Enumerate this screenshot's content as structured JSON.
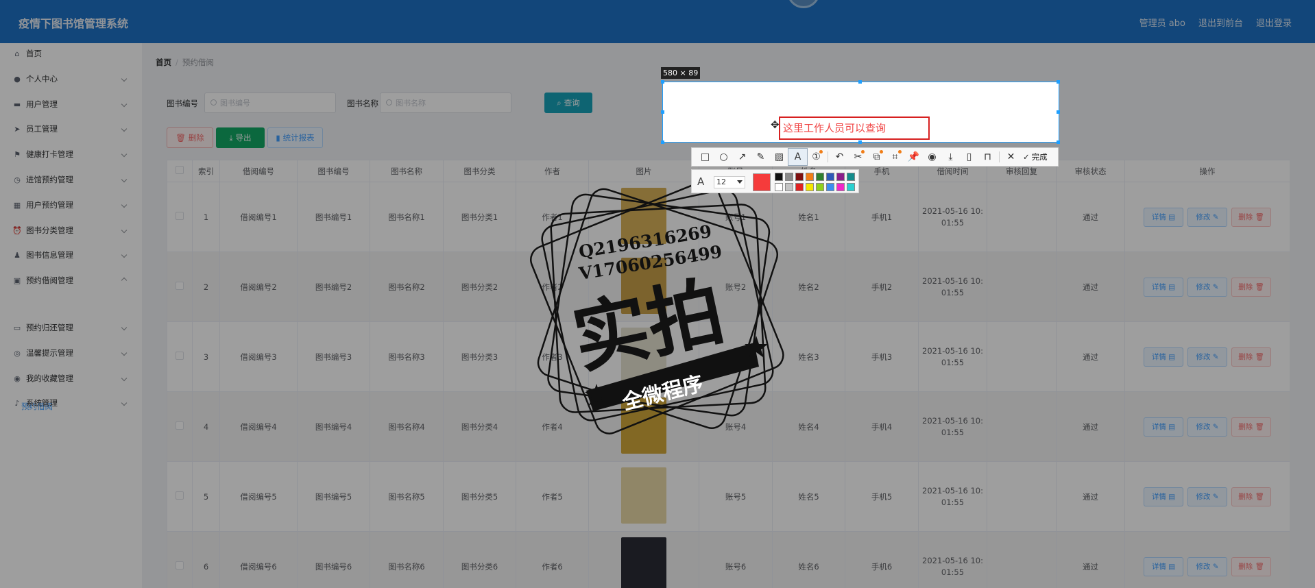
{
  "app_title": "疫情下图书馆管理系统",
  "header_links": [
    "管理员 abo",
    "退出到前台",
    "退出登录"
  ],
  "sidebar": {
    "items": [
      {
        "label": "首页",
        "icon": "home-icon",
        "glyph": "⌂",
        "chevron": "none"
      },
      {
        "label": "个人中心",
        "icon": "user-icon",
        "glyph": "●",
        "chevron": "down"
      },
      {
        "label": "用户管理",
        "icon": "users-icon",
        "glyph": "▬",
        "chevron": "down"
      },
      {
        "label": "员工管理",
        "icon": "send-icon",
        "glyph": "➤",
        "chevron": "down"
      },
      {
        "label": "健康打卡管理",
        "icon": "flag-icon",
        "glyph": "⚑",
        "chevron": "down"
      },
      {
        "label": "进馆预约管理",
        "icon": "clock-icon",
        "glyph": "◷",
        "chevron": "down"
      },
      {
        "label": "用户预约管理",
        "icon": "grid-icon",
        "glyph": "▦",
        "chevron": "down"
      },
      {
        "label": "图书分类管理",
        "icon": "alarm-icon",
        "glyph": "⏰",
        "chevron": "down"
      },
      {
        "label": "图书信息管理",
        "icon": "person-icon",
        "glyph": "♟",
        "chevron": "down"
      },
      {
        "label": "预约借阅管理",
        "icon": "apps-icon",
        "glyph": "▣",
        "chevron": "up"
      },
      {
        "label": "预约归还管理",
        "icon": "chat-icon",
        "glyph": "▭",
        "chevron": "down"
      },
      {
        "label": "温馨提示管理",
        "icon": "compass-icon",
        "glyph": "◎",
        "chevron": "down"
      },
      {
        "label": "我的收藏管理",
        "icon": "support-icon",
        "glyph": "◉",
        "chevron": "down"
      },
      {
        "label": "系统管理",
        "icon": "mic-icon",
        "glyph": "♪",
        "chevron": "down"
      }
    ],
    "active_sub": "预约借阅"
  },
  "breadcrumb": {
    "home": "首页",
    "sep": "/",
    "current": "预约借阅"
  },
  "search": {
    "label1": "图书编号",
    "placeholder1": "图书编号",
    "label2": "图书名称",
    "placeholder2": "图书名称",
    "query": "查询"
  },
  "buttons": {
    "delete": "删除",
    "export": "导出",
    "report": "统计报表"
  },
  "table": {
    "headers": [
      "",
      "索引",
      "借阅编号",
      "图书编号",
      "图书名称",
      "图书分类",
      "作者",
      "图片",
      "账号",
      "姓名",
      "手机",
      "借阅时间",
      "审核回复",
      "审核状态",
      "操作"
    ],
    "rows": [
      {
        "idx": "1",
        "borrow_no": "借阅编号1",
        "book_no": "图书编号1",
        "book_name": "图书名称1",
        "category": "图书分类1",
        "author": "作者1",
        "account": "账号1",
        "name": "姓名1",
        "phone": "手机1",
        "time1": "2021-05-16 10:",
        "time2": "01:55",
        "reply": "",
        "status": "通过",
        "cover": "#d9b25a"
      },
      {
        "idx": "2",
        "borrow_no": "借阅编号2",
        "book_no": "图书编号2",
        "book_name": "图书名称2",
        "category": "图书分类2",
        "author": "作者2",
        "account": "账号2",
        "name": "姓名2",
        "phone": "手机2",
        "time1": "2021-05-16 10:",
        "time2": "01:55",
        "reply": "",
        "status": "通过",
        "cover": "#c9a04a"
      },
      {
        "idx": "3",
        "borrow_no": "借阅编号3",
        "book_no": "图书编号3",
        "book_name": "图书名称3",
        "category": "图书分类3",
        "author": "作者3",
        "account": "账号3",
        "name": "姓名3",
        "phone": "手机3",
        "time1": "2021-05-16 10:",
        "time2": "01:55",
        "reply": "",
        "status": "通过",
        "cover": "#e6e2d0"
      },
      {
        "idx": "4",
        "borrow_no": "借阅编号4",
        "book_no": "图书编号4",
        "book_name": "图书名称4",
        "category": "图书分类4",
        "author": "作者4",
        "account": "账号4",
        "name": "姓名4",
        "phone": "手机4",
        "time1": "2021-05-16 10:",
        "time2": "01:55",
        "reply": "",
        "status": "通过",
        "cover": "#d2a93a"
      },
      {
        "idx": "5",
        "borrow_no": "借阅编号5",
        "book_no": "图书编号5",
        "book_name": "图书名称5",
        "category": "图书分类5",
        "author": "作者5",
        "account": "账号5",
        "name": "姓名5",
        "phone": "手机5",
        "time1": "2021-05-16 10:",
        "time2": "01:55",
        "reply": "",
        "status": "通过",
        "cover": "#e8d8a6"
      },
      {
        "idx": "6",
        "borrow_no": "借阅编号6",
        "book_no": "图书编号6",
        "book_name": "图书名称6",
        "category": "图书分类6",
        "author": "作者6",
        "account": "账号6",
        "name": "姓名6",
        "phone": "手机6",
        "time1": "2021-05-16 10:",
        "time2": "01:55",
        "reply": "",
        "status": "通过",
        "cover": "#2a2c36"
      }
    ],
    "actions": {
      "detail": "详情",
      "edit": "修改",
      "delete": "删除"
    }
  },
  "watermark": {
    "line1": "Q2196316269",
    "line2": "V17060256499",
    "big": "实拍",
    "ribbon": "全微程序"
  },
  "screenshot_tool": {
    "size_label": "580 × 89",
    "text_value": "这里工作人员可以查询",
    "done_label": "完成",
    "font_size": "12",
    "current_color": "#f53b3b",
    "palette": [
      "#111111",
      "#8a8a8a",
      "#7f1010",
      "#f07d17",
      "#2f7f2f",
      "#2e59b8",
      "#8a1e8a",
      "#148c8c",
      "#ffffff",
      "#c4c4c4",
      "#e02222",
      "#f5e600",
      "#8fd11c",
      "#3b8ef0",
      "#f028c8",
      "#2ad0d0"
    ]
  },
  "colors": {
    "header": "#1e72c5",
    "accent": "#409eff",
    "query": "#17a2b8",
    "export": "#13a864",
    "danger": "#f56c6c"
  }
}
